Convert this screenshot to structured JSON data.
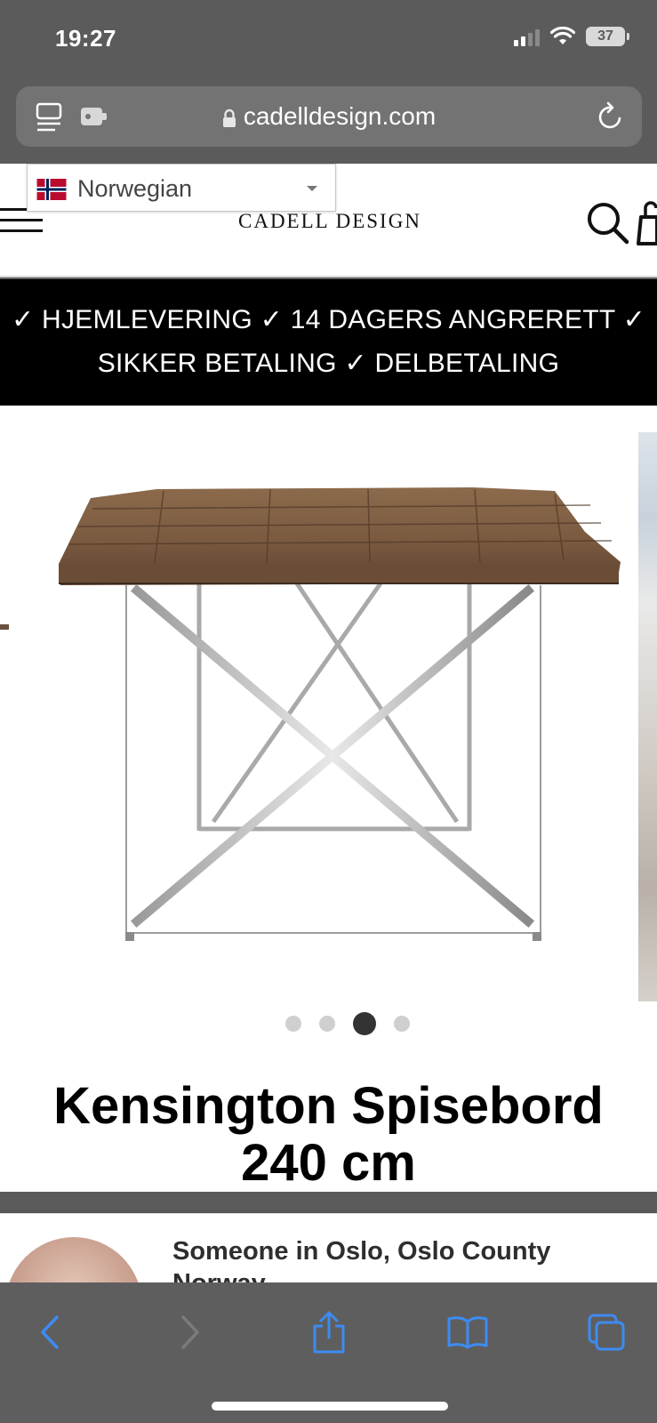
{
  "status_bar": {
    "time": "19:27",
    "battery": "37"
  },
  "browser": {
    "url": "cadelldesign.com"
  },
  "header": {
    "language": "Norwegian",
    "logo": "CADELL DESIGN"
  },
  "announcement": {
    "line1": "✓ HJEMLEVERING ✓ 14 DAGERS ANGRERETT ✓",
    "line2": "SIKKER BETALING ✓ DELBETALING"
  },
  "gallery": {
    "slide_count": 4,
    "active_slide": 3
  },
  "product": {
    "title_line1": "Kensington Spisebord",
    "title_line2": "240 cm"
  },
  "popup": {
    "line1": "Someone in Oslo, Oslo County",
    "line2": "Norway"
  },
  "icons": {
    "reader": "reader-icon",
    "extension": "extension-icon",
    "lock": "lock-icon",
    "reload": "reload-icon",
    "menu": "hamburger-icon",
    "flag": "norway-flag-icon",
    "search": "search-icon",
    "cart": "cart-icon",
    "back": "back-arrow-icon",
    "forward": "forward-arrow-icon",
    "share": "share-icon",
    "bookmarks": "bookmarks-icon",
    "tabs": "tabs-icon"
  },
  "colors": {
    "accent": "#2f8cff",
    "chrome": "#5b5b5b",
    "announcement_bg": "#000000"
  }
}
